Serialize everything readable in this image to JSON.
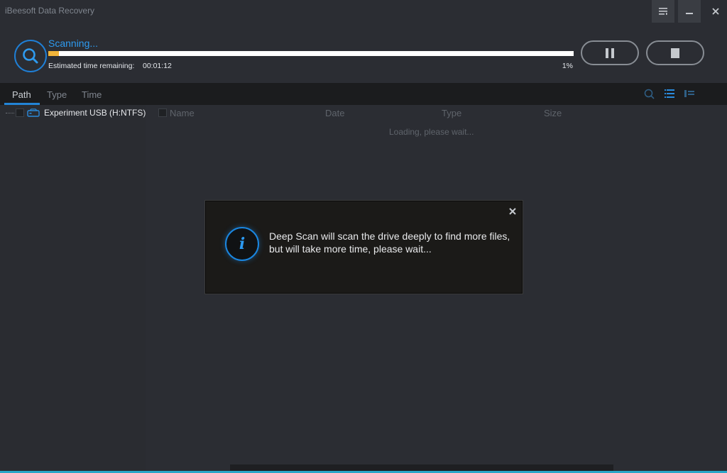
{
  "window": {
    "title": "iBeesoft Data Recovery",
    "controls": [
      "menu-icon",
      "minimize-icon",
      "close-icon"
    ]
  },
  "scan": {
    "status": "Scanning...",
    "eta_label": "Estimated time remaining:",
    "eta_value": "00:01:12",
    "progress_percent": 1,
    "percent_label": "1%",
    "buttons": [
      "pause-icon",
      "stop-icon"
    ]
  },
  "tabs": [
    {
      "label": "Path",
      "active": true
    },
    {
      "label": "Type",
      "active": false
    },
    {
      "label": "Time",
      "active": false
    }
  ],
  "toolbar_icons": [
    "search-icon",
    "list-view-icon",
    "detail-view-icon"
  ],
  "tree": {
    "items": [
      {
        "label": "Experiment USB (H:NTFS)",
        "icon": "usb-drive-icon"
      }
    ]
  },
  "file_list": {
    "columns": [
      "Name",
      "Date",
      "Type",
      "Size"
    ],
    "loading_text": "Loading, please wait..."
  },
  "dialog": {
    "icon": "info-icon",
    "glyph": "i",
    "message": "Deep Scan will scan the drive deeply to find more files, but will take more time, please wait..."
  },
  "colors": {
    "accent": "#2e9bf0",
    "progress": "#f2b53a",
    "background": "#2b2d33",
    "toolbar": "#1b1c1e"
  }
}
